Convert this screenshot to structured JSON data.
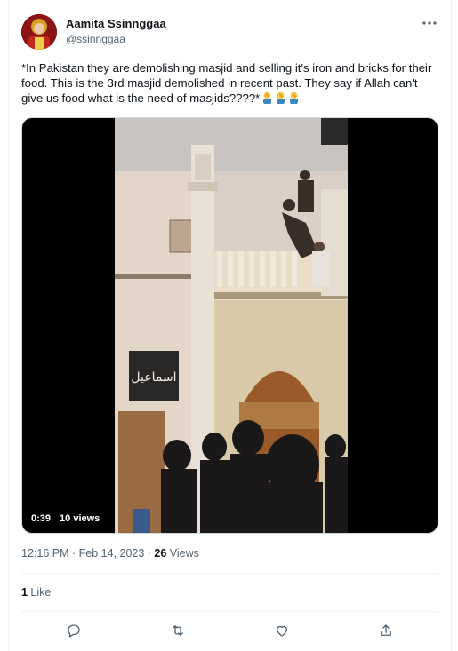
{
  "author": {
    "display_name": "Aamita Ssinnggaa",
    "handle": "@ssinnggaa"
  },
  "tweet": {
    "text": "*In Pakistan they are demolishing masjid and selling it's iron and bricks for their food. This is the 3rd masjid demolished in recent past. They say if Allah can't give us food what is the need of masjids????*",
    "emojis": [
      "man-facepalming-emoji",
      "man-facepalming-emoji",
      "man-facepalming-emoji"
    ]
  },
  "video": {
    "duration": "0:39",
    "views": "10 views",
    "sign_text": "اسماعیل"
  },
  "meta": {
    "time": "12:16 PM",
    "separator": " · ",
    "date": "Feb 14, 2023",
    "separator2": " · ",
    "views_count": "26",
    "views_label": " Views"
  },
  "engagement": {
    "likes_count": "1",
    "likes_label": " Like"
  },
  "actions": [
    "reply",
    "retweet",
    "like",
    "share"
  ],
  "colors": {
    "text": "#0f1419",
    "secondary": "#536471",
    "border": "#eff3f4"
  }
}
